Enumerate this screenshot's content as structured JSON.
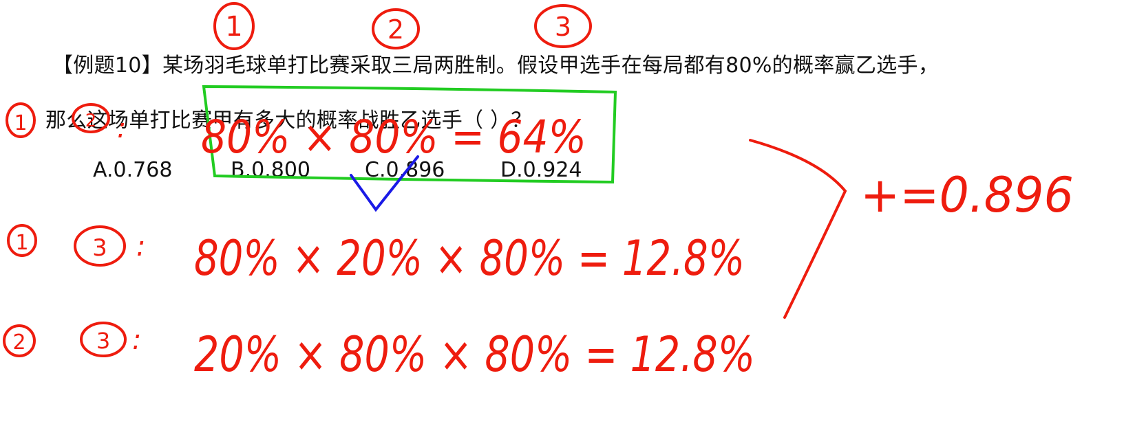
{
  "question": {
    "line1": "【例题10】某场羽毛球单打比赛采取三局两胜制。假设甲选手在每局都有80%的概率赢乙选手，",
    "line2": "那么这场单打比赛甲有多大的概率战胜乙选手（ ）？"
  },
  "options": [
    {
      "label": "A.0.768"
    },
    {
      "label": "B.0.800"
    },
    {
      "label": "C.0.896"
    },
    {
      "label": "D.0.924"
    }
  ],
  "annotations": {
    "game_numbers": [
      "1",
      "2",
      "3"
    ],
    "scenario1": {
      "left": "1",
      "right": "2",
      "expr": "80% × 80% = 64%"
    },
    "scenario2": {
      "left": "1",
      "right": "3",
      "expr": "80% × 20% × 80% = 12.8%"
    },
    "scenario3": {
      "left": "2",
      "right": "3",
      "expr": "20% × 80% × 80% = 12.8%"
    },
    "total": "+=0.896",
    "ink_color": "#ee1c0e",
    "box_color": "#22cc22",
    "check_color": "#1a1ae6"
  }
}
